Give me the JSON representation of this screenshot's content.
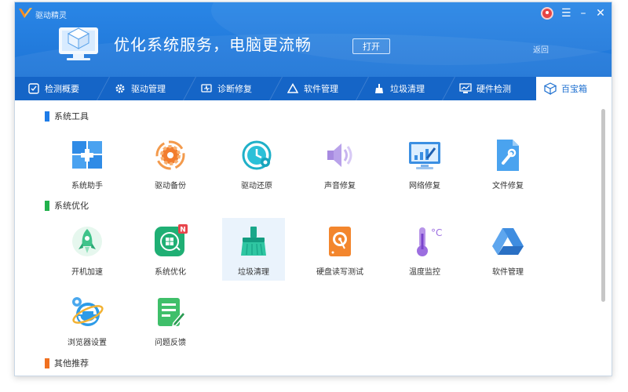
{
  "app": {
    "name": "驱动精灵"
  },
  "header": {
    "title": "优化系统服务，电脑更流畅",
    "open_label": "打开",
    "back_label": "返回"
  },
  "tabs": [
    {
      "label": "检测概要",
      "icon": "monitor-check-icon"
    },
    {
      "label": "驱动管理",
      "icon": "gear-icon"
    },
    {
      "label": "诊断修复",
      "icon": "stethoscope-icon"
    },
    {
      "label": "软件管理",
      "icon": "drive-triangle-icon"
    },
    {
      "label": "垃圾清理",
      "icon": "broom-icon"
    },
    {
      "label": "硬件检测",
      "icon": "chart-monitor-icon"
    },
    {
      "label": "百宝箱",
      "icon": "toolbox-icon",
      "active": true
    }
  ],
  "sections": {
    "system_tools": {
      "title": "系统工具",
      "color": "#1e7ce8",
      "items": [
        "系统助手",
        "驱动备份",
        "驱动还原",
        "声音修复",
        "网络修复",
        "文件修复"
      ]
    },
    "system_optimize": {
      "title": "系统优化",
      "color": "#22b14c",
      "items": [
        "开机加速",
        "系统优化",
        "垃圾清理",
        "硬盘读写测试",
        "温度监控",
        "软件管理",
        "浏览器设置",
        "问题反馈"
      ],
      "badge": "N"
    },
    "others": {
      "title": "其他推荐",
      "color": "#f07020"
    }
  },
  "colors": {
    "header_blue": "#1d74d6",
    "tab_bar": "#1565c7",
    "accent": "#1c6fd0"
  }
}
